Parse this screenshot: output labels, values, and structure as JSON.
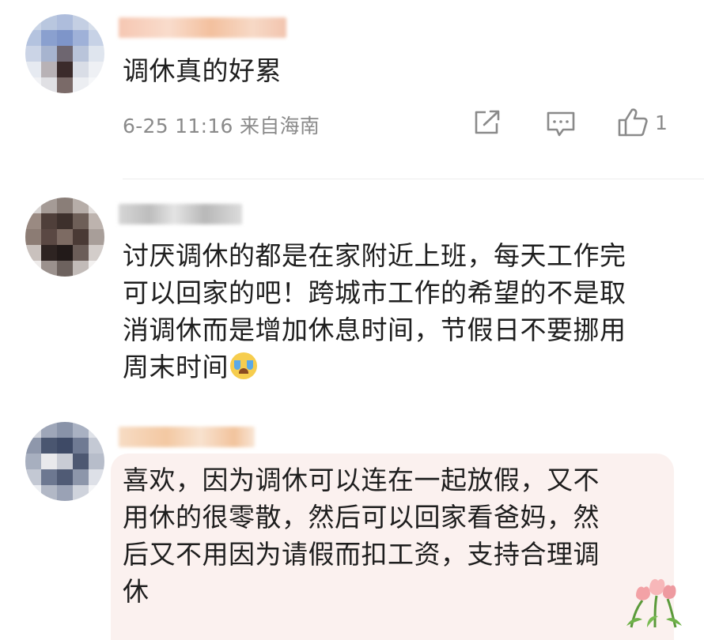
{
  "comments": [
    {
      "text_lines": [
        "调休真的好累"
      ],
      "meta": "6-25 11:16 来自海南",
      "likes": "1",
      "icons": [
        "share-icon",
        "comment-icon",
        "thumbs-up-icon"
      ]
    },
    {
      "text_lines": [
        "讨厌调休的都是在家附近上班，每天工作完",
        "可以回家的吧！跨城市工作的希望的不是取",
        "消调休而是增加休息时间，节假日不要挪用",
        "周末时间"
      ],
      "emoji": "crying-face-emoji"
    },
    {
      "text_lines": [
        "喜欢，因为调休可以连在一起放假，又不",
        "用休的很零散，然后可以回家看爸妈，然",
        "后又不用因为请假而扣工资，支持合理调",
        "休"
      ],
      "sticker": "tulips-sticker"
    }
  ],
  "colors": {
    "text": "#1e1e1e",
    "meta": "#8a8a8a",
    "bubble": "#fbf1ef",
    "divider": "#ececec"
  }
}
